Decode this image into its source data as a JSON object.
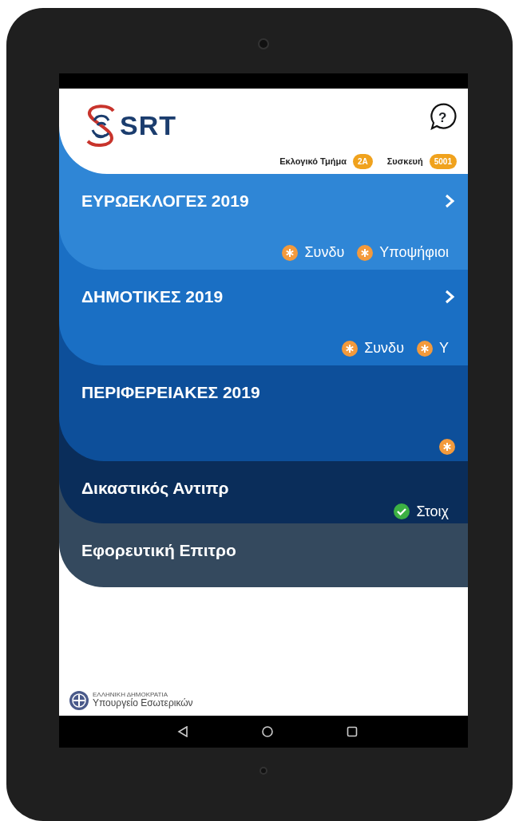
{
  "header": {
    "logo_text": "SRT",
    "help_icon": "?",
    "info": [
      {
        "label": "Εκλογικό Τμήμα",
        "value": "2A"
      },
      {
        "label": "Συσκευή",
        "value": "5001"
      }
    ]
  },
  "cards": [
    {
      "title": "ΕΥΡΩΕΚΛΟΓΕΣ 2019",
      "chevron": true,
      "badges": [
        {
          "kind": "star",
          "text": "Συνδυ"
        },
        {
          "kind": "star",
          "text": "Υποψήφιοι"
        }
      ]
    },
    {
      "title": "ΔΗΜΟΤΙΚΕΣ 2019",
      "chevron": true,
      "badges": [
        {
          "kind": "star",
          "text": "Συνδυ"
        },
        {
          "kind": "star",
          "text": "Υ"
        }
      ]
    },
    {
      "title": "ΠΕΡΙΦΕΡΕΙΑΚΕΣ 2019",
      "chevron": false,
      "badges": [
        {
          "kind": "star"
        }
      ]
    },
    {
      "title": "Δικαστικός Αντιπρ",
      "chevron": false,
      "badges": [
        {
          "kind": "check",
          "text": "Στοιχ"
        }
      ]
    },
    {
      "title": "Εφορευτική Επιτρο",
      "chevron": false
    }
  ],
  "footer": {
    "line1": "ΕΛΛΗΝΙΚΗ ΔΗΜΟΚΡΑΤΙΑ",
    "line2": "Υπουργείο Εσωτερικών"
  }
}
